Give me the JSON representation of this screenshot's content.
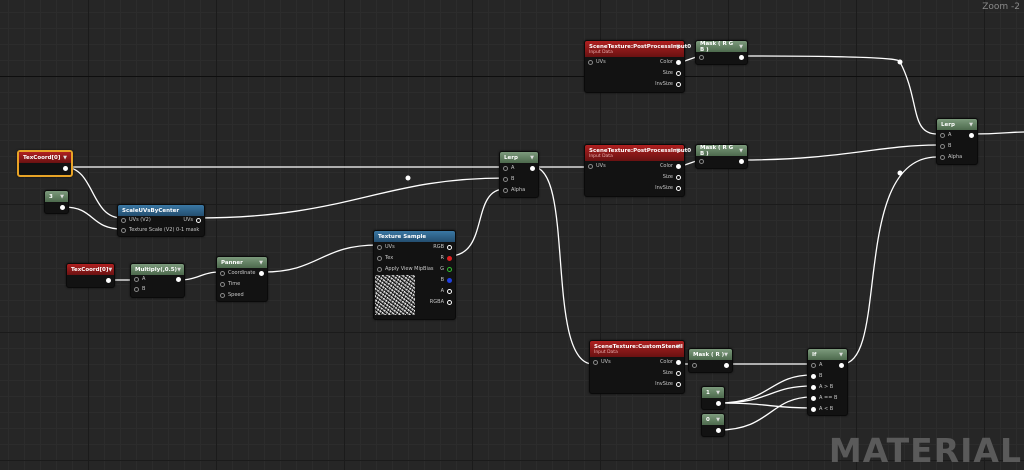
{
  "zoom_label": "Zoom -2",
  "watermark": "MATERIAL",
  "nodes": {
    "texcoord0_a": {
      "title": "TexCoord[0]"
    },
    "const3": {
      "title": "3"
    },
    "scale_uvs": {
      "title": "ScaleUVsByCenter",
      "in_uvs": "UVs (V2)",
      "out_uvs": "UVs",
      "in_scale": "Texture Scale (V2) 0-1 mask"
    },
    "texcoord0_b": {
      "title": "TexCoord[0]"
    },
    "multiply": {
      "title": "Multiply(,0.5)",
      "a": "A",
      "b": "B"
    },
    "panner": {
      "title": "Panner",
      "coordinate": "Coordinate",
      "time": "Time",
      "speed": "Speed"
    },
    "texture_sample": {
      "title": "Texture Sample",
      "uvs": "UVs",
      "tex": "Tex",
      "mip": "Apply View MipBias",
      "rgb": "RGB",
      "r": "R",
      "g": "G",
      "b": "B",
      "a": "A",
      "rgba": "RGBA"
    },
    "lerp_mid": {
      "title": "Lerp",
      "a": "A",
      "b": "B",
      "alpha": "Alpha"
    },
    "scene_tex_1": {
      "title": "SceneTexture:PostProcessInput0",
      "subtitle": "Input Data",
      "uvs": "UVs",
      "color": "Color",
      "size": "Size",
      "invsize": "InvSize"
    },
    "scene_tex_2": {
      "title": "SceneTexture:PostProcessInput0",
      "subtitle": "Input Data",
      "uvs": "UVs",
      "color": "Color",
      "size": "Size",
      "invsize": "InvSize"
    },
    "scene_tex_stencil": {
      "title": "SceneTexture:CustomStencil",
      "subtitle": "Input Data",
      "uvs": "UVs",
      "color": "Color",
      "size": "Size",
      "invsize": "InvSize"
    },
    "mask_rgb_1": {
      "title": "Mask ( R G B )"
    },
    "mask_rgb_2": {
      "title": "Mask ( R G B )"
    },
    "mask_r": {
      "title": "Mask ( R )"
    },
    "lerp_final": {
      "title": "Lerp",
      "a": "A",
      "b": "B",
      "alpha": "Alpha"
    },
    "if_node": {
      "title": "If",
      "a": "A",
      "b": "B",
      "agb": "A > B",
      "aeb": "A == B",
      "alb": "A < B"
    },
    "const1": {
      "title": "1"
    },
    "const0": {
      "title": "0"
    }
  },
  "colors": {
    "selected_border": "#e8a326",
    "red_header": "#9a1a1a",
    "green_header": "#6b876b",
    "blue_header": "#2f6690",
    "wire": "#ffffff"
  }
}
